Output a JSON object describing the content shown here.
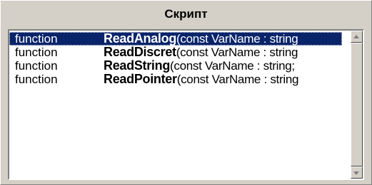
{
  "panel": {
    "title": "Скрипт"
  },
  "list": {
    "items": [
      {
        "keyword": "function",
        "name": "ReadAnalog",
        "params": "(const VarName : string",
        "selected": true
      },
      {
        "keyword": "function",
        "name": "ReadDiscret",
        "params": "(const VarName : string",
        "selected": false
      },
      {
        "keyword": "function",
        "name": "ReadString",
        "params": "(const VarName : string;",
        "selected": false
      },
      {
        "keyword": "function",
        "name": "ReadPointer",
        "params": "(const VarName : string",
        "selected": false
      }
    ]
  },
  "scrollbar": {
    "up_icon": "arrow-up-icon",
    "down_icon": "arrow-down-icon"
  },
  "colors": {
    "selection": "#0a246a",
    "face": "#d4d0c8"
  }
}
